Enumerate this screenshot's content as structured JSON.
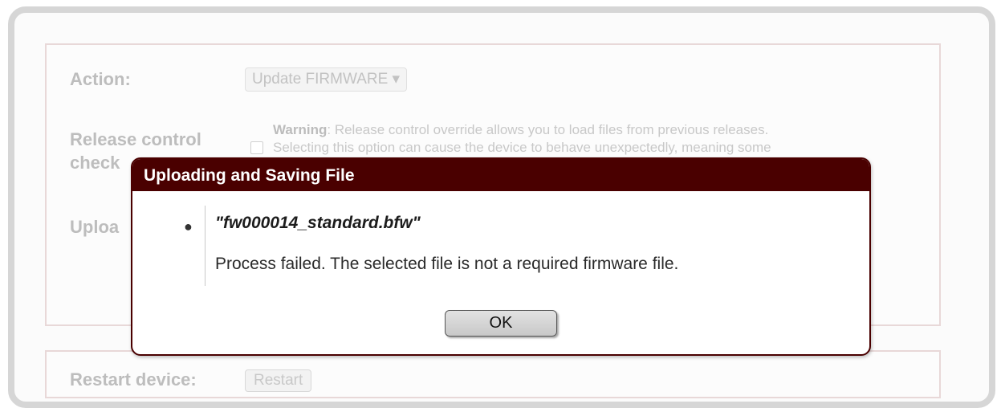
{
  "form": {
    "action_label": "Action:",
    "action_value": "Update FIRMWARE ▾",
    "release_label_1": "Release control",
    "release_label_2": "check",
    "warning_bold": "Warning",
    "warning_text_1": ": Release control override allows you to load files from previous releases.",
    "warning_text_2": "Selecting this option can cause the device to behave unexpectedly, meaning some",
    "upload_label": "Uploa",
    "restart_label": "Restart device:",
    "restart_button": "Restart"
  },
  "dialog": {
    "title": "Uploading and Saving File",
    "filename": "\"fw000014_standard.bfw\"",
    "message": "Process failed. The selected file is not a required firmware file.",
    "ok_label": "OK"
  }
}
